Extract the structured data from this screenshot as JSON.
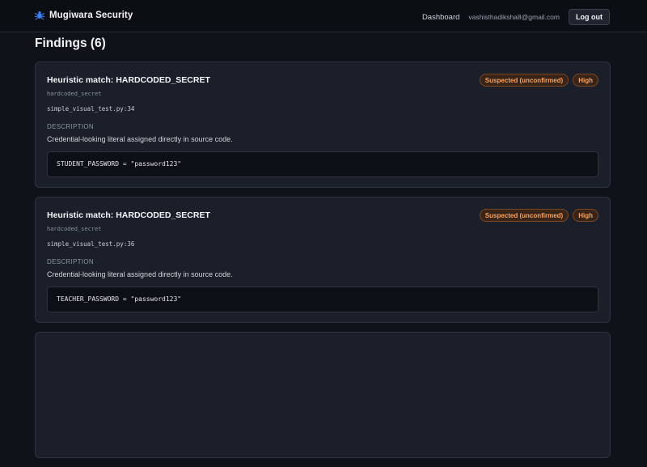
{
  "brand": {
    "name": "Mugiwara Security",
    "icon": "bug-icon",
    "accent_color": "#3b82f6"
  },
  "nav": {
    "dashboard_label": "Dashboard",
    "user_email": "vashisthadiksha8@gmail.com",
    "logout_label": "Log out"
  },
  "page": {
    "title": "Findings (6)"
  },
  "findings": [
    {
      "title": "Heuristic match: HARDCODED_SECRET",
      "status_badge": "Suspected (unconfirmed)",
      "severity_badge": "High",
      "rule_id": "hardcoded_secret",
      "location": "simple_visual_test.py:34",
      "description_label": "DESCRIPTION",
      "description": "Credential-looking literal assigned directly in source code.",
      "code": "STUDENT_PASSWORD = \"password123\""
    },
    {
      "title": "Heuristic match: HARDCODED_SECRET",
      "status_badge": "Suspected (unconfirmed)",
      "severity_badge": "High",
      "rule_id": "hardcoded_secret",
      "location": "simple_visual_test.py:36",
      "description_label": "DESCRIPTION",
      "description": "Credential-looking literal assigned directly in source code.",
      "code": "TEACHER_PASSWORD = \"password123\""
    }
  ],
  "colors": {
    "background": "#0f1218",
    "card": "#1b1f2a",
    "badge_text": "#f4a460",
    "badge_border": "#7a4726"
  }
}
